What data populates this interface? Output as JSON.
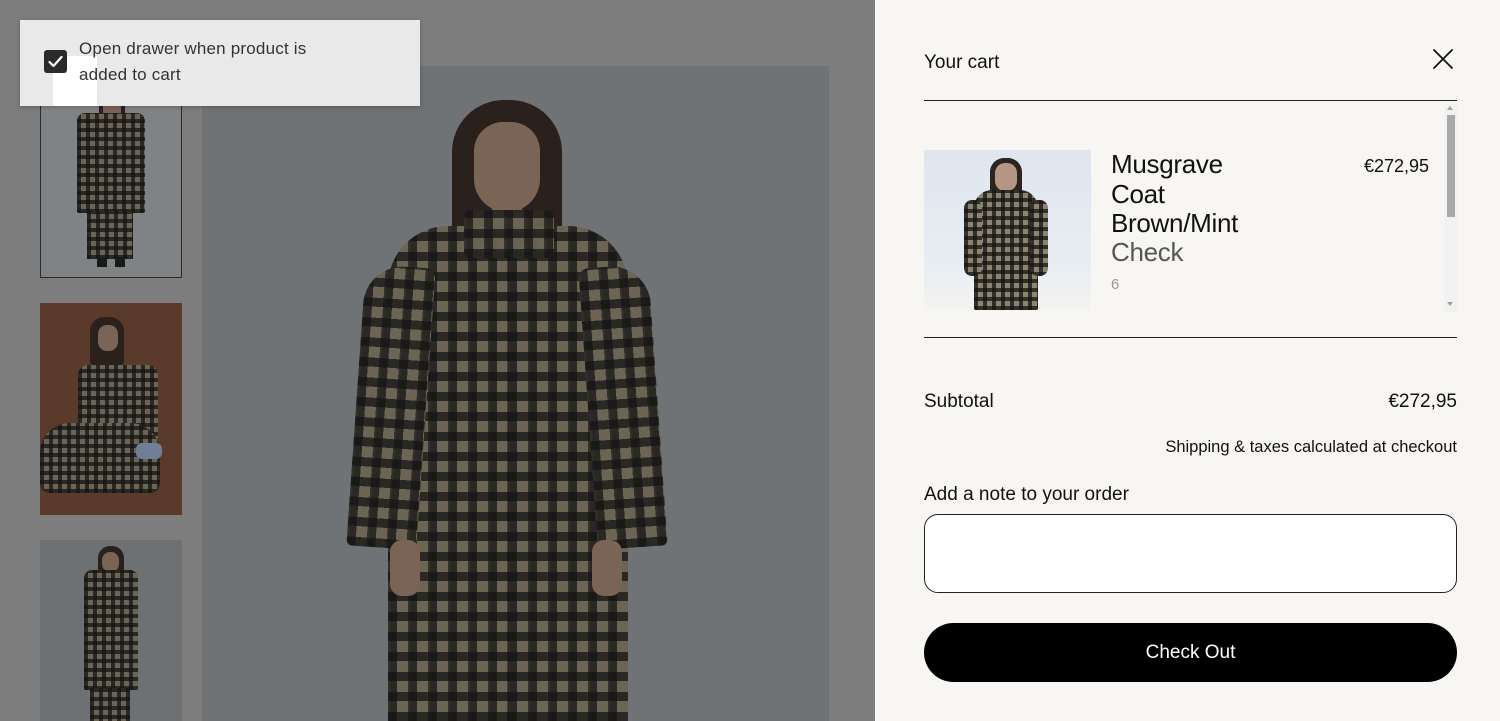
{
  "toast": {
    "checked": true,
    "message": "Open drawer when product is added to cart"
  },
  "gallery": {
    "thumbnails": [
      "check-coat-front",
      "check-coat-seated",
      "check-coat-side"
    ],
    "main_image": "check-coat-model-front"
  },
  "cart": {
    "title": "Your cart",
    "close_icon": "close-icon",
    "items": [
      {
        "name": "Musgrave Coat Brown/Mint",
        "variant": "Check",
        "quantity": "6",
        "price": "€272,95"
      }
    ],
    "subtotal_label": "Subtotal",
    "subtotal_value": "€272,95",
    "shipping_note": "Shipping & taxes calculated at checkout",
    "note_label": "Add a note to your order",
    "note_value": "",
    "checkout_label": "Check Out"
  },
  "colors": {
    "drawer_bg": "#f8f6f3",
    "overlay": "#7d7d7d",
    "button_bg": "#000000",
    "button_text": "#ffffff"
  }
}
